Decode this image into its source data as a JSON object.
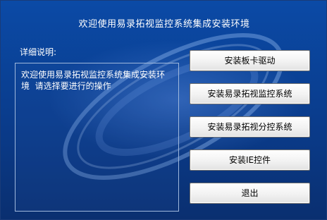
{
  "window": {
    "title": "欢迎使用易录拓视监控系统集成安装环境"
  },
  "details": {
    "label": "详细说明:",
    "text": "欢迎使用易录拓视监控系统集成安装环境  请选择要进行的操作"
  },
  "buttons": {
    "install_driver": "安装板卡驱动",
    "install_monitor": "安装易录拓视监控系统",
    "install_sub_monitor": "安装易录拓视分控系统",
    "install_ie_control": "安装IE控件",
    "exit": "退出"
  },
  "colors": {
    "background": "#0a3c8c",
    "button_face": "#f2f2f2",
    "text": "#ffffff"
  }
}
